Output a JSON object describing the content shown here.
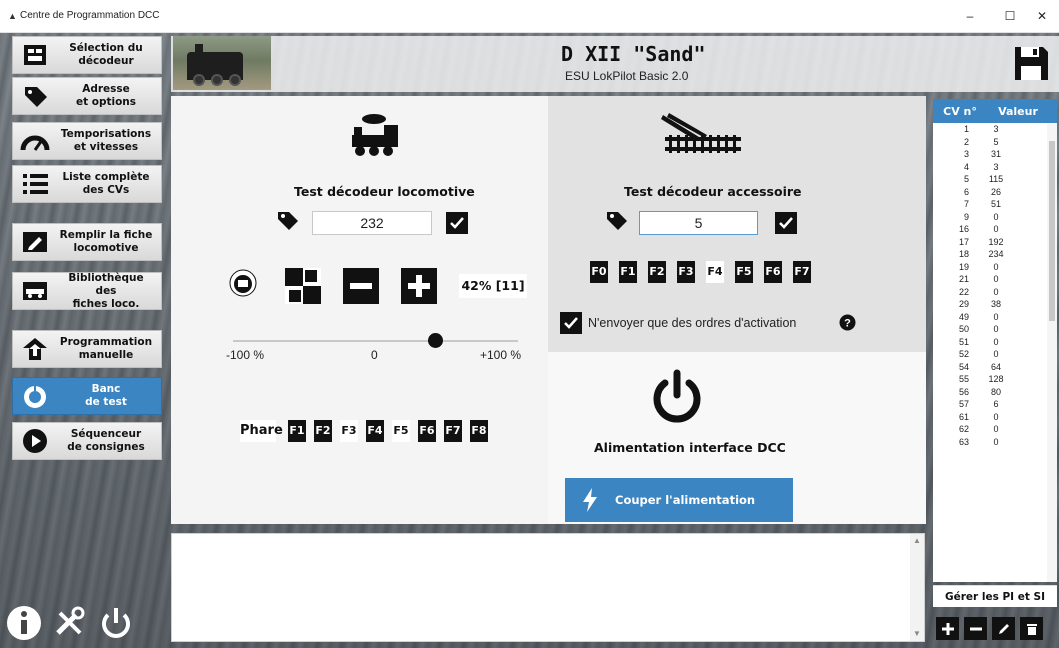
{
  "window": {
    "title": "Centre de Programmation DCC",
    "minimize": "–",
    "maximize": "☐",
    "close": "✕"
  },
  "sidebar": {
    "items": [
      {
        "label": "Sélection du\ndécodeur",
        "icon": "decoder-chip-icon"
      },
      {
        "label": "Adresse\net options",
        "icon": "tag-icon"
      },
      {
        "label": "Temporisations\net vitesses",
        "icon": "speedometer-icon"
      },
      {
        "label": "Liste complète\ndes CVs",
        "icon": "list-icon"
      },
      {
        "label": "Remplir la fiche\nlocomotive",
        "icon": "pencil-icon"
      },
      {
        "label": "Bibliothèque des\nfiches loco.",
        "icon": "locomotive-library-icon"
      },
      {
        "label": "Programmation\nmanuelle",
        "icon": "download-arrow-icon"
      },
      {
        "label": "Banc\nde test",
        "icon": "gauge-dial-icon",
        "active": true
      },
      {
        "label": "Séquenceur\nde consignes",
        "icon": "play-icon"
      }
    ]
  },
  "header": {
    "loco_name": "D XII \"Sand\"",
    "decoder": "ESU LokPilot Basic 2.0"
  },
  "loco_test": {
    "title": "Test décodeur locomotive",
    "address": "232",
    "speed_text": "42% [11]",
    "slider_min": "-100 %",
    "slider_mid": "0",
    "slider_max": "+100 %",
    "slider_value": 42,
    "emergency_label": "EMERGENCY",
    "emergency_sub": "STOP",
    "headlight_label": "Phare",
    "functions": [
      {
        "label": "F1",
        "on": true
      },
      {
        "label": "F2",
        "on": true
      },
      {
        "label": "F3",
        "on": false
      },
      {
        "label": "F4",
        "on": true
      },
      {
        "label": "F5",
        "on": false
      },
      {
        "label": "F6",
        "on": true
      },
      {
        "label": "F7",
        "on": true
      },
      {
        "label": "F8",
        "on": true
      }
    ]
  },
  "accessory_test": {
    "title": "Test décodeur accessoire",
    "address": "5",
    "functions": [
      {
        "label": "F0",
        "on": true
      },
      {
        "label": "F1",
        "on": true
      },
      {
        "label": "F2",
        "on": true
      },
      {
        "label": "F3",
        "on": true
      },
      {
        "label": "F4",
        "on": false
      },
      {
        "label": "F5",
        "on": true
      },
      {
        "label": "F6",
        "on": true
      },
      {
        "label": "F7",
        "on": true
      }
    ],
    "only_activation_label": "N'envoyer que des ordres d'activation",
    "only_activation_checked": true
  },
  "power": {
    "title": "Alimentation interface DCC",
    "button_label": "Couper l'alimentation"
  },
  "cv_table": {
    "col_cv": "CV n°",
    "col_value": "Valeur",
    "rows": [
      [
        "1",
        "3"
      ],
      [
        "2",
        "5"
      ],
      [
        "3",
        "31"
      ],
      [
        "4",
        "3"
      ],
      [
        "5",
        "115"
      ],
      [
        "6",
        "26"
      ],
      [
        "7",
        "51"
      ],
      [
        "9",
        "0"
      ],
      [
        "16",
        "0"
      ],
      [
        "17",
        "192"
      ],
      [
        "18",
        "234"
      ],
      [
        "19",
        "0"
      ],
      [
        "21",
        "0"
      ],
      [
        "22",
        "0"
      ],
      [
        "29",
        "38"
      ],
      [
        "49",
        "0"
      ],
      [
        "50",
        "0"
      ],
      [
        "51",
        "0"
      ],
      [
        "52",
        "0"
      ],
      [
        "54",
        "64"
      ],
      [
        "55",
        "128"
      ],
      [
        "56",
        "80"
      ],
      [
        "57",
        "6"
      ],
      [
        "61",
        "0"
      ],
      [
        "62",
        "0"
      ],
      [
        "63",
        "0"
      ]
    ],
    "manage_label": "Gérer les PI et SI"
  },
  "colors": {
    "accent": "#3a85c2",
    "dark": "#111111"
  }
}
